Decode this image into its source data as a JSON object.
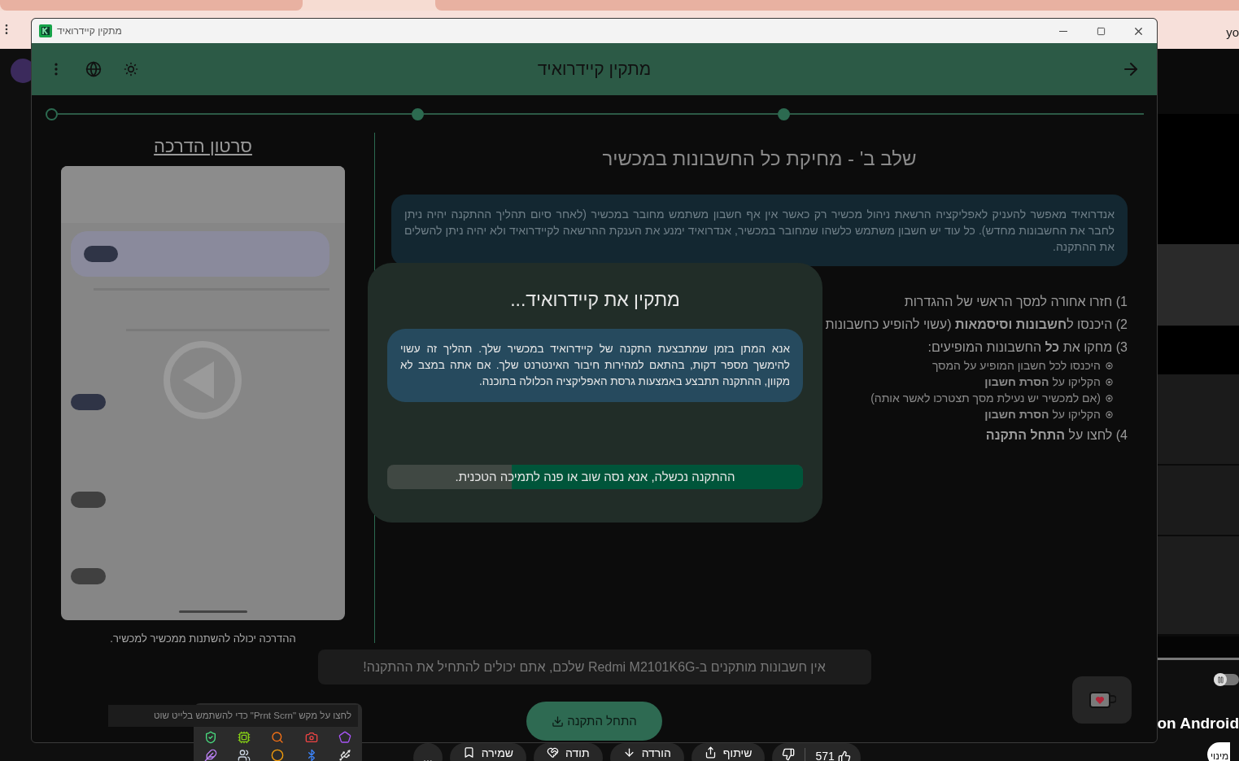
{
  "browser": {
    "address_text": "yo",
    "video_title": "on Android",
    "subscribe_button": "מינוי",
    "video_progress": {
      "level": 1
    },
    "autoplay": {
      "on": false
    },
    "actions": [
      {
        "kind": "like",
        "label": "571"
      },
      {
        "kind": "share",
        "label": "שיתוף"
      },
      {
        "kind": "download",
        "label": "הורדה"
      },
      {
        "kind": "thanks",
        "label": "תודה"
      },
      {
        "kind": "save",
        "label": "שמירה"
      },
      {
        "kind": "more",
        "label": "..."
      }
    ]
  },
  "window": {
    "title": "מתקין קיידרואיד"
  },
  "header": {
    "title": "מתקין קיידרואיד"
  },
  "stepper": [
    {
      "done": true
    },
    {
      "done": true
    },
    {
      "done": false
    }
  ],
  "tutorial": {
    "title": "סרטון הדרכה",
    "caption": "ההדרכה יכולה להשתנות ממכשיר למכשיר."
  },
  "step": {
    "title": "שלב ב' - מחיקת כל החשבונות במכשיר",
    "note": "אנדרואיד מאפשר להעניק לאפליקציה הרשאת ניהול מכשיר רק כאשר אין אף חשבון משתמש מחובר במכשיר (לאחר סיום תהליך ההתקנה יהיה ניתן לחבר את החשבונות מחדש). כל עוד יש חשבון משתמש כלשהו שמחובר במכשיר, אנדרואיד ימנע את הענקת ההרשאה לקיידרואיד ולא יהיה ניתן להשלים את ההתקנה.",
    "instructions": [
      {
        "text": "1) חזרו אחורה למסך הראשי של ההגדרות"
      },
      {
        "text": "2) היכנסו ל**חשבונות וסיסמאות** (עשוי להופיע כחשבונות"
      },
      {
        "text": "3) מחקו את **כל** החשבונות המופיעים:",
        "children": [
          {
            "text": "היכנסו לכל חשבון המופיע על המסך"
          },
          {
            "text": "הקליקו על **הסרת חשבון**"
          },
          {
            "text": "(אם למכשיר יש נעילת מסך תצטרכו לאשר אותה)"
          },
          {
            "text": "הקליקו על **הסרת חשבון**"
          }
        ]
      },
      {
        "text": "4) לחצו על **התחל התקנה**"
      }
    ]
  },
  "dialog": {
    "title": "מתקין את קיידרואיד...",
    "message": "אנא המתן בזמן שמתבצעת התקנה של קיידרואיד במכשיר שלך. תהליך זה עשוי להימשך מספר דקות, בהתאם למהירות חיבור האינטרנט שלך. אם אתה במצב לא מקוון, ההתקנה תתבצע באמצעות גרסת האפליקציה הכלולה בתוכנה.",
    "progress": {
      "level": 0.7,
      "text": "ההתקנה נכשלה, אנא נסה שוב או פנה לתמיכה הטכנית."
    }
  },
  "status_message": "אין חשבונות מותקנים ב-Redmi M2101K6G שלכם, אתם יכולים להתחיל את ההתקנה!",
  "start_button": "התחל התקנה",
  "tooltip": "לחצו על מקש \"Prnt Scrn\" כדי להשתמש בלייט שוט"
}
